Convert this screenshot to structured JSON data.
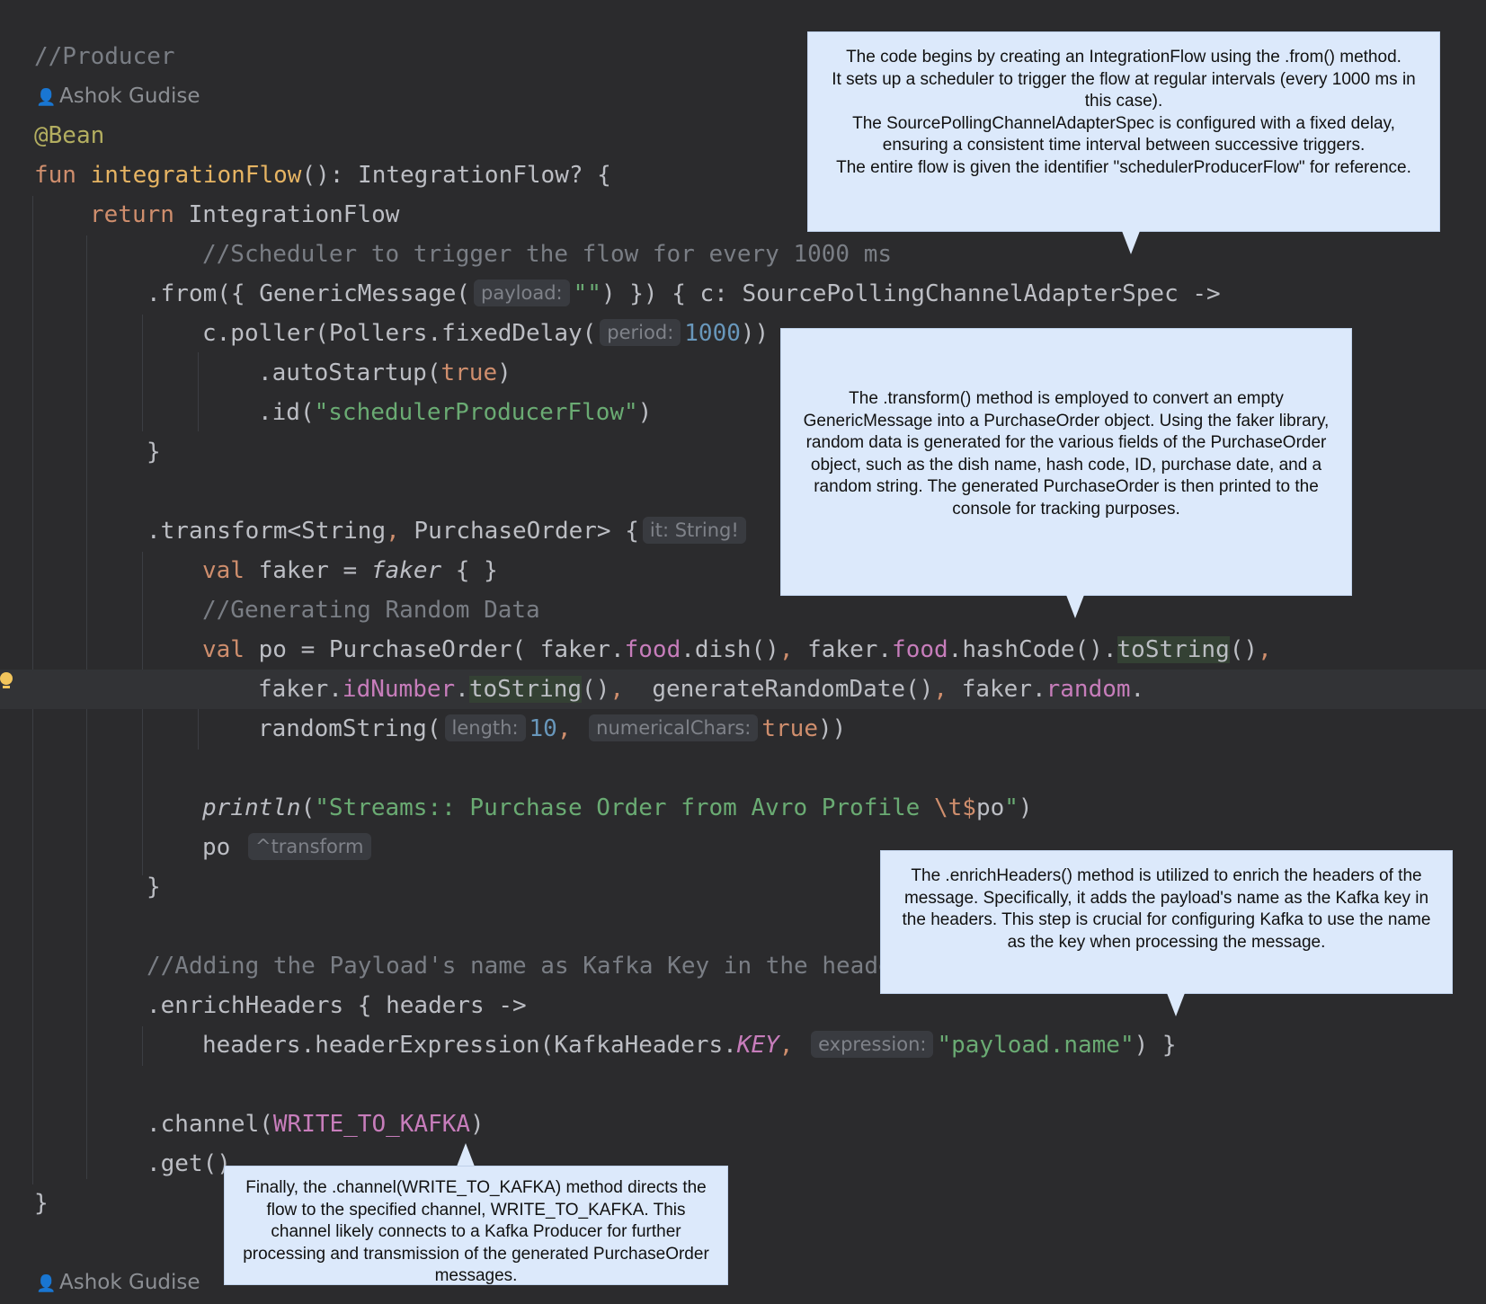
{
  "editor": {
    "comment_producer": "//Producer",
    "author": "Ashok Gudise",
    "annotation_bean": "@Bean",
    "kw_fun": "fun",
    "fn_name": "integrationFlow",
    "sig_rest": "(): IntegrationFlow? {",
    "kw_return": "return",
    "integration_flow": "IntegrationFlow",
    "comment_scheduler": "//Scheduler to trigger the flow for every 1000 ms",
    "from_call_start": ".from({ GenericMessage(",
    "hint_payload": "payload:",
    "empty_string": "\"\"",
    "from_call_end": ") }) { c: SourcePollingChannelAdapterSpec ->",
    "poller_start": "c.poller(Pollers.fixedDelay(",
    "hint_period": "period:",
    "poller_value": "1000",
    "poller_end": "))",
    "auto_startup_start": ".autoStartup(",
    "kw_true": "true",
    "close_paren": ")",
    "id_start": ".id(",
    "id_value": "\"schedulerProducerFlow\"",
    "close_brace": "}",
    "transform_start": ".transform<String",
    "comma": ",",
    "transform_type2": " PurchaseOrder> {",
    "hint_it": "it: String!",
    "kw_val": "val",
    "faker_assign": " faker = ",
    "faker_ident": "faker",
    "faker_block": " { }",
    "comment_random": "//Generating Random Data",
    "po_assign": " po = PurchaseOrder( faker.",
    "prop_food": "food",
    "dish_call": ".dish()",
    "faker_dot": " faker.",
    "hashcode_call": ".hashCode().",
    "to_string": "toString",
    "parens": "()",
    "faker_prefix": "faker.",
    "prop_id_number": "idNumber",
    "dot": ".",
    "gen_date": "  generateRandomDate()",
    "prop_random": "random",
    "random_string_start": "randomString(",
    "hint_length": "length:",
    "len_value": "10",
    "hint_numerical": "numericalChars:",
    "random_string_end": "))",
    "println_fn": "println",
    "open_paren": "(",
    "println_string": "\"Streams:: Purchase Order from Avro Profile ",
    "escape_seq": "\\t$",
    "println_var": "po",
    "println_quote": "\"",
    "po_ident": "po",
    "hint_transform": "^transform",
    "comment_headers": "//Adding the Payload's name as Kafka Key in the heade",
    "enrich_start": ".enrichHeaders { headers ->",
    "header_expr_start": "headers.headerExpression(KafkaHeaders.",
    "kafka_key": "KEY",
    "hint_expression": "expression:",
    "payload_name": "\"payload.name\"",
    "header_expr_end": ") }",
    "channel_start": ".channel(",
    "write_to_kafka": "WRITE_TO_KAFKA",
    "get_call": ".get()"
  },
  "callouts": {
    "from": [
      "The code begins by creating an IntegrationFlow using the .from() method.",
      "It sets up a scheduler to trigger the flow at regular intervals (every 1000 ms in this case).",
      "The SourcePollingChannelAdapterSpec is configured with a fixed delay, ensuring a consistent time interval between successive triggers.",
      "The entire flow is given the identifier \"schedulerProducerFlow\" for reference."
    ],
    "transform": "The .transform() method is employed to convert an empty GenericMessage into a PurchaseOrder object. Using the faker library, random data is generated for the various fields of the PurchaseOrder object, such as the dish name, hash code, ID, purchase date, and a random string. The generated PurchaseOrder is then printed to the console for tracking purposes.",
    "enrich": "The .enrichHeaders() method is utilized to enrich the headers of the message. Specifically, it adds the payload's name as the Kafka key in the headers. This step is crucial for configuring Kafka to use the name as the key when processing the message.",
    "channel": "Finally, the .channel(WRITE_TO_KAFKA) method directs the flow to the specified channel, WRITE_TO_KAFKA. This channel likely connects to a Kafka Producer for further processing and transmission of the generated PurchaseOrder messages."
  },
  "colors": {
    "background": "#2b2b2d",
    "callout_bg": "#dce9fb"
  }
}
